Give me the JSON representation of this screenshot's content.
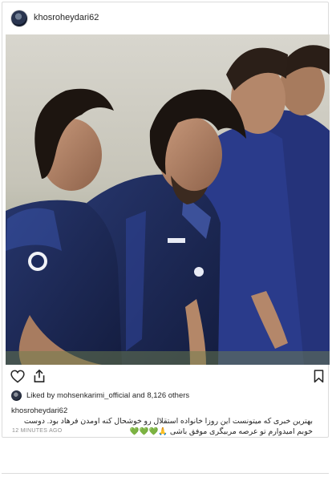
{
  "post": {
    "username": "khosroheydari62",
    "photo_icon": "photo-of-football-players",
    "likes": {
      "prefix": "Liked by",
      "user": "mohsenkarimi_official",
      "suffix": "and 8,126 others"
    },
    "caption": {
      "user": "khosroheydari62",
      "text": "بهترین خبری که میتونست این روزا خانواده استقلال رو خوشحال کنه اومدن فرهاد بود. دوست خوبم امیدوارم تو عرصه مربیگری موفق باشی 🙏💚💚💚"
    },
    "time": "12 MINUTES AGO"
  },
  "icons": {
    "like": "heart-icon",
    "share": "share-icon",
    "save": "bookmark-icon"
  },
  "colors": {
    "text": "#262626",
    "muted": "#8e8e8e",
    "border": "#dbdbdb",
    "jersey": "#1c2a5c"
  }
}
